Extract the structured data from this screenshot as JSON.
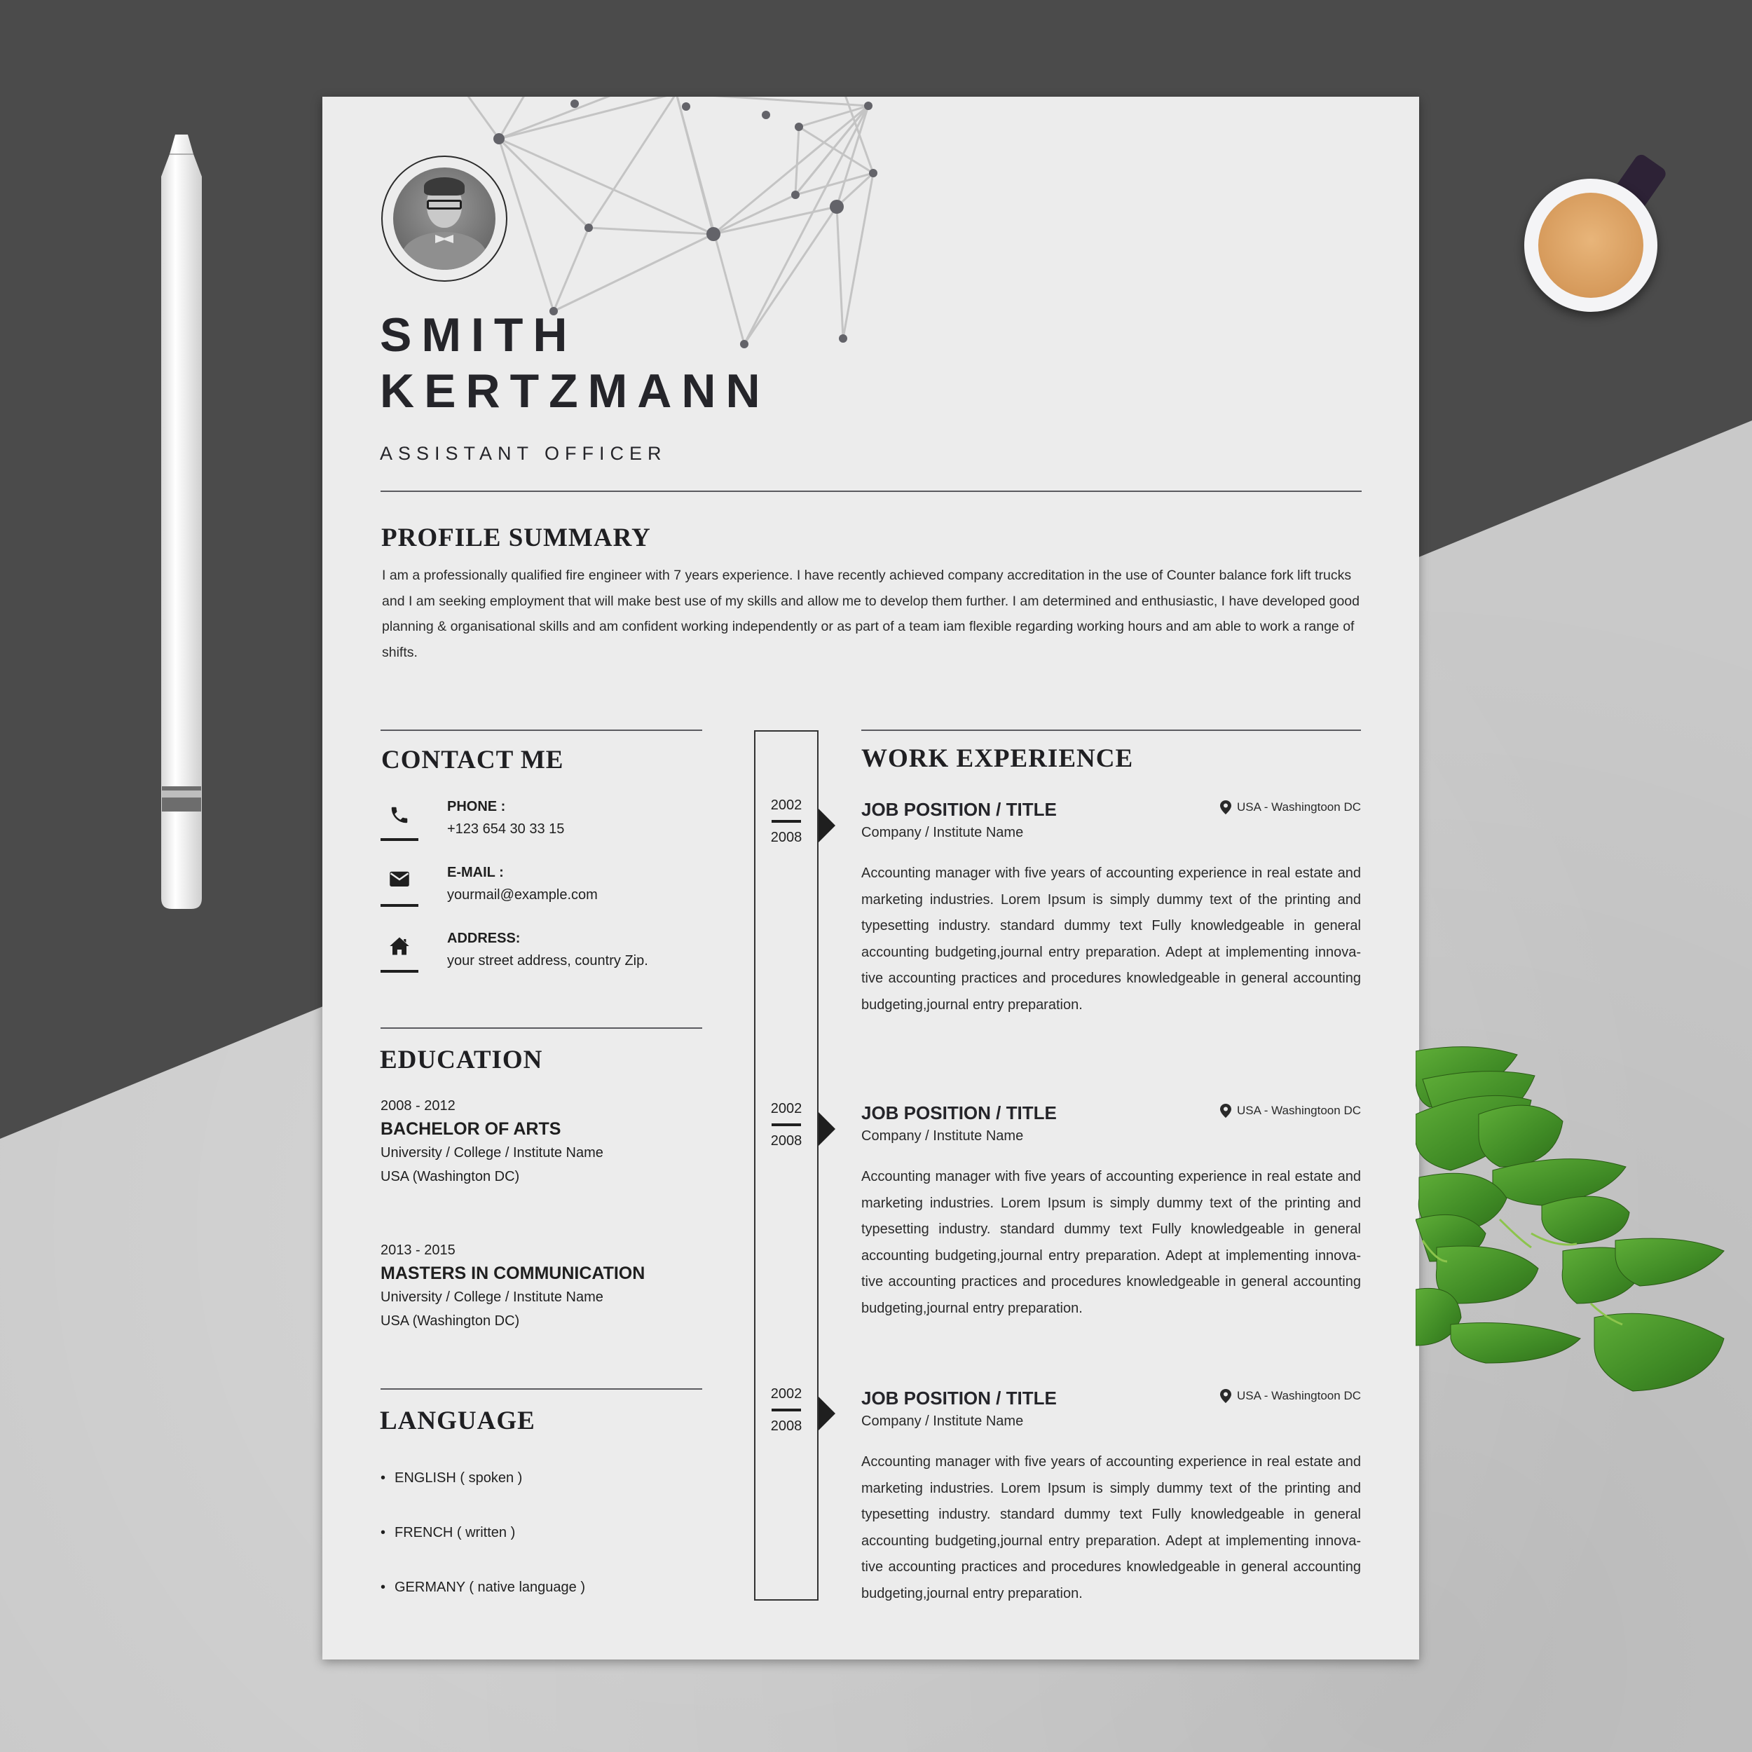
{
  "document": {
    "type": "resume",
    "name_line1": "SMITH",
    "name_line2": "KERTZMANN",
    "role": "ASSISTANT OFFICER"
  },
  "profile": {
    "title": "PROFILE SUMMARY",
    "text": "I am a professionally qualified fire engineer with 7 years experience. I have recently achieved company accreditation in the use of Counter balance fork lift trucks and I am seeking employment that will make best use of my skills and allow me to develop them further. I am determined and enthusiastic, I have developed good planning & organisational skills and am confident working independently or as part of a team iam flexible regarding working hours and am able to work a range of shifts."
  },
  "contact": {
    "title": "CONTACT ME",
    "items": [
      {
        "icon": "phone-icon",
        "label": "PHONE :",
        "value": "+123 654 30 33 15"
      },
      {
        "icon": "mail-icon",
        "label": "E-MAIL :",
        "value": "yourmail@example.com"
      },
      {
        "icon": "home-icon",
        "label": "ADDRESS:",
        "value": "your street address, country Zip."
      }
    ]
  },
  "education": {
    "title": "EDUCATION",
    "items": [
      {
        "years": "2008 - 2012",
        "degree": "BACHELOR OF ARTS",
        "school": "University / College / Institute Name",
        "location": "USA (Washington DC)"
      },
      {
        "years": "2013 - 2015",
        "degree": "MASTERS IN COMMUNICATION",
        "school": "University / College / Institute Name",
        "location": "USA (Washington DC)"
      }
    ]
  },
  "language": {
    "title": "LANGUAGE",
    "items": [
      "ENGLISH ( spoken )",
      "FRENCH ( written )",
      "GERMANY ( native language )"
    ]
  },
  "work": {
    "title": "WORK EXPERIENCE",
    "items": [
      {
        "start": "2002",
        "end": "2008",
        "title": "JOB POSITION / TITLE",
        "company": "Company / Institute Name",
        "location": "USA - Washingtoon DC",
        "description": "Accounting manager with five years of accounting experience in real estate and marketing industries. Lorem Ipsum is simply dummy text of the printing and typesetting industry.  standard dummy text Fully knowledgeable in general accounting budgeting,journal entry preparation. Adept at implementing innova-tive accounting practices and procedures knowledgeable in general accounting budgeting,journal entry preparation."
      },
      {
        "start": "2002",
        "end": "2008",
        "title": "JOB POSITION / TITLE",
        "company": "Company / Institute Name",
        "location": "USA - Washingtoon DC",
        "description": "Accounting manager with five years of accounting experience in real estate and marketing industries. Lorem Ipsum is simply dummy text of the printing and typesetting industry.  standard dummy text Fully knowledgeable in general accounting budgeting,journal entry preparation. Adept at implementing innova-tive accounting practices and procedures knowledgeable in general accounting budgeting,journal entry preparation."
      },
      {
        "start": "2002",
        "end": "2008",
        "title": "JOB POSITION / TITLE",
        "company": "Company / Institute Name",
        "location": "USA - Washingtoon DC",
        "description": "Accounting manager with five years of accounting experience in real estate and marketing industries. Lorem Ipsum is simply dummy text of the printing and typesetting industry.  standard dummy text Fully knowledgeable in general accounting budgeting,journal entry preparation. Adept at implementing innova-tive accounting practices and procedures knowledgeable in general accounting budgeting,journal entry preparation."
      }
    ]
  },
  "colors": {
    "paper": "#ececec",
    "text": "#1f1f22",
    "network_line": "#c4c4c4",
    "network_node": "#636369",
    "desk_dark": "#4b4b4b",
    "desk_light": "#c9c9c9",
    "leaf": "#4f9a2f"
  }
}
